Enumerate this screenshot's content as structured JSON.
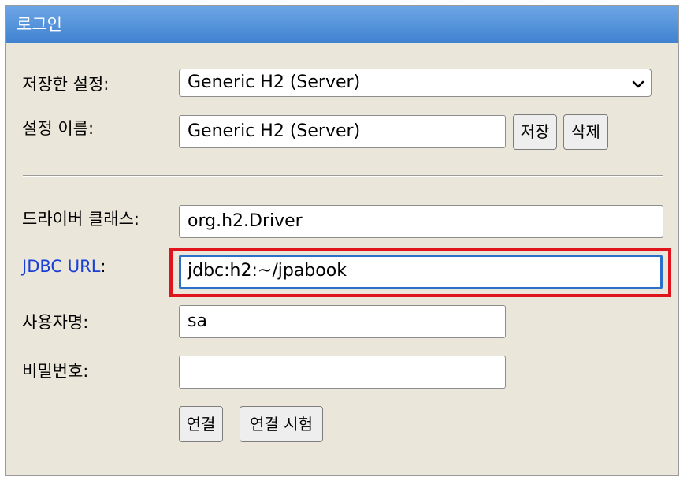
{
  "window": {
    "title": "로그인"
  },
  "form": {
    "saved_settings": {
      "label": "저장한 설정:",
      "value": "Generic H2 (Server)"
    },
    "setting_name": {
      "label": "설정 이름:",
      "value": "Generic H2 (Server)"
    },
    "save_button": "저장",
    "delete_button": "삭제",
    "driver_class": {
      "label": "드라이버 클래스:",
      "value": "org.h2.Driver"
    },
    "jdbc_url": {
      "label_link": "JDBC URL",
      "label_suffix": ":",
      "value": "jdbc:h2:~/jpabook"
    },
    "username": {
      "label": "사용자명:",
      "value": "sa"
    },
    "password": {
      "label": "비밀번호:",
      "value": ""
    },
    "connect_button": "연결",
    "test_connection_button": "연결 시험"
  },
  "colors": {
    "title_bar": "#4a8bd8",
    "panel_background": "#ebe6da",
    "highlight_border": "#e0141c",
    "link_text": "#1a3fd6",
    "focus_border": "#2a6fc9"
  },
  "icons": {
    "select_arrow": "chevron-down-icon"
  }
}
